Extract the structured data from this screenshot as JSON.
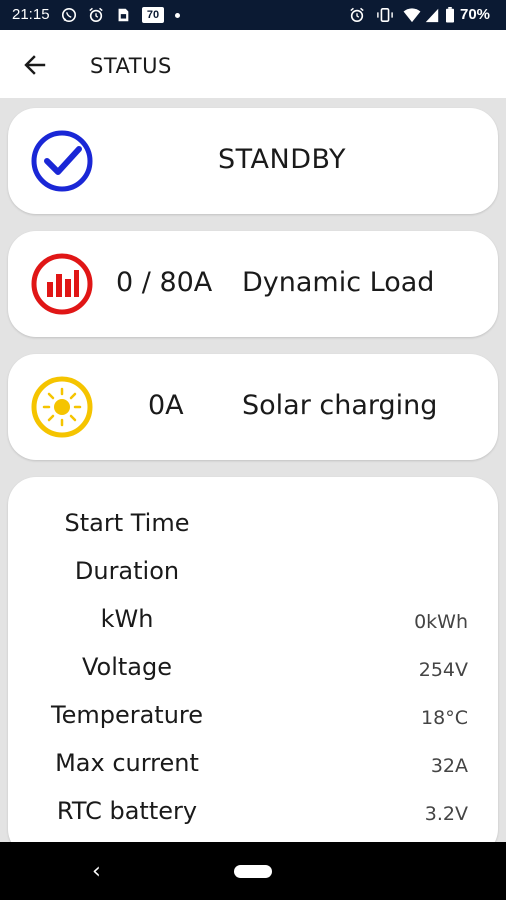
{
  "status_bar": {
    "time": "21:15",
    "box_label": "70",
    "battery_percent": "70%",
    "left_icons": [
      "whatsapp-icon",
      "alarm-icon",
      "sim-icon"
    ],
    "right_icons": [
      "alarm-icon",
      "vibrate-icon",
      "wifi-icon",
      "signal-icon",
      "battery-icon"
    ]
  },
  "app_bar": {
    "title": "STATUS",
    "back_icon": "arrow-left-icon"
  },
  "status_card": {
    "icon": "check-circle-icon",
    "icon_color": "#1a27d6",
    "text": "STANDBY"
  },
  "load_card": {
    "icon": "bar-chart-icon",
    "icon_color": "#e01616",
    "value": "0 / 80A",
    "label": "Dynamic Load"
  },
  "solar_card": {
    "icon": "sun-icon",
    "icon_color": "#f5c400",
    "value": "0A",
    "label": "Solar charging"
  },
  "info": {
    "rows": [
      {
        "label": "Start Time",
        "value": ""
      },
      {
        "label": "Duration",
        "value": ""
      },
      {
        "label": "kWh",
        "value": "0kWh"
      },
      {
        "label": "Voltage",
        "value": "254V"
      },
      {
        "label": "Temperature",
        "value": "18°C"
      },
      {
        "label": "Max current",
        "value": "32A"
      },
      {
        "label": "RTC battery",
        "value": "3.2V"
      }
    ]
  },
  "nav_bar": {
    "back_icon": "nav-back-icon",
    "home_icon": "nav-home-icon"
  }
}
